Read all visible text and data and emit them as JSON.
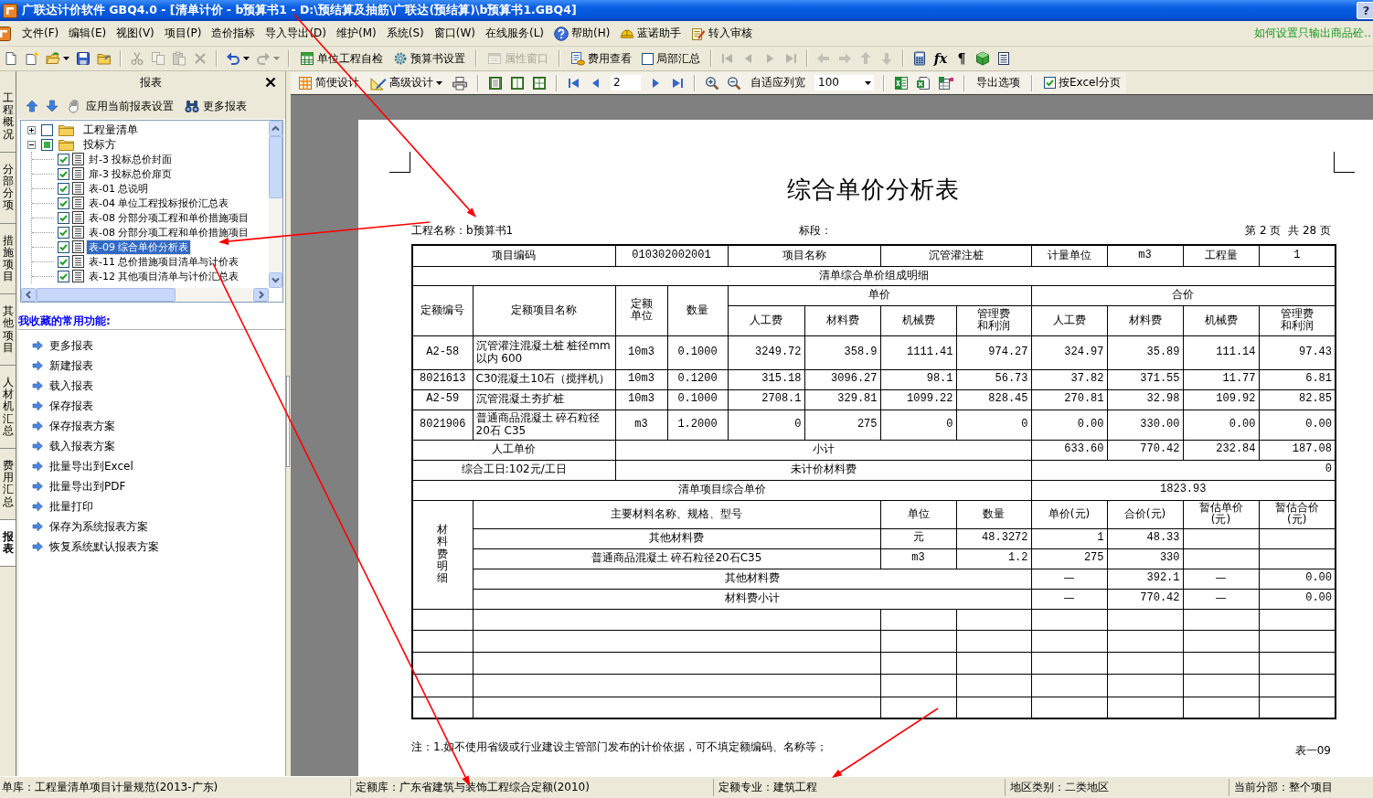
{
  "window": {
    "title": "广联达计价软件 GBQ4.0 - [清单计价 - b预算书1 - D:\\预结算及抽筋\\广联达(预结算)\\b预算书1.GBQ4]",
    "help_button": "?"
  },
  "menu": {
    "items": [
      {
        "label": "文件(F)",
        "kind": "text"
      },
      {
        "label": "编辑(E)",
        "kind": "text"
      },
      {
        "label": "视图(V)",
        "kind": "text"
      },
      {
        "label": "项目(P)",
        "kind": "text"
      },
      {
        "label": "造价指标",
        "kind": "text"
      },
      {
        "label": "导入导出(D)",
        "kind": "text"
      },
      {
        "label": "维护(M)",
        "kind": "text"
      },
      {
        "label": "系统(S)",
        "kind": "text"
      },
      {
        "label": "窗口(W)",
        "kind": "text"
      },
      {
        "label": "在线服务(L)",
        "kind": "text"
      },
      {
        "label": "帮助(H)",
        "kind": "help"
      },
      {
        "label": "蓝诺助手",
        "kind": "helper"
      },
      {
        "label": "转入审核",
        "kind": "review"
      }
    ],
    "tip_link": "如何设置只输出商品砼.."
  },
  "toolbar": [
    {
      "kind": "file",
      "disabled": false
    },
    {
      "kind": "edit",
      "disabled": true
    },
    {
      "kind": "undo",
      "disabled": false
    },
    {
      "kind": "redo",
      "disabled": true
    },
    {
      "kind": "button",
      "label": "单位工程自检",
      "disabled": false
    },
    {
      "kind": "button",
      "label": "预算书设置",
      "disabled": false
    },
    {
      "kind": "button",
      "label": "属性窗口",
      "disabled": true
    },
    {
      "kind": "button",
      "label": "费用查看",
      "disabled": false
    },
    {
      "kind": "checkbox",
      "label": "局部汇总",
      "checked": false
    },
    {
      "kind": "nav",
      "disabled": true
    },
    {
      "kind": "move",
      "disabled": true
    },
    {
      "kind": "tools",
      "disabled": false,
      "glyphs": [
        "fx",
        "¶"
      ]
    }
  ],
  "side_tabs": [
    {
      "label": "工程概况",
      "selected": false
    },
    {
      "label": "分部分项",
      "selected": false
    },
    {
      "label": "措施项目",
      "selected": false
    },
    {
      "label": "其他项目",
      "selected": false
    },
    {
      "label": "人材机汇总",
      "selected": false
    },
    {
      "label": "费用汇总",
      "selected": false
    },
    {
      "label": "报表",
      "selected": true
    }
  ],
  "report_panel": {
    "title": "报表",
    "apply_button": "应用当前报表设置",
    "more_button": "更多报表",
    "tree": [
      {
        "label": "工程量清单",
        "expanded": false,
        "checked": false,
        "partial": false,
        "selected": false
      },
      {
        "label": "投标方",
        "expanded": true,
        "checked": false,
        "partial": true,
        "selected": false,
        "children": [
          {
            "label": "封-3 投标总价封面",
            "checked": true,
            "selected": false
          },
          {
            "label": "扉-3 投标总价扉页",
            "checked": true,
            "selected": false
          },
          {
            "label": "表-01 总说明",
            "checked": true,
            "selected": false
          },
          {
            "label": "表-04 单位工程投标报价汇总表",
            "checked": true,
            "selected": false
          },
          {
            "label": "表-08 分部分项工程和单价措施项目",
            "checked": true,
            "selected": false
          },
          {
            "label": "表-08 分部分项工程和单价措施项目",
            "checked": true,
            "selected": false
          },
          {
            "label": "表-09 综合单价分析表",
            "checked": true,
            "selected": true
          },
          {
            "label": "表-11 总价措施项目清单与计价表",
            "checked": true,
            "selected": false
          },
          {
            "label": "表-12 其他项目清单与计价汇总表",
            "checked": true,
            "selected": false
          }
        ]
      }
    ],
    "favorites_title": "我收藏的常用功能:",
    "favorites": [
      "更多报表",
      "新建报表",
      "载入报表",
      "保存报表",
      "保存报表方案",
      "载入报表方案",
      "批量导出到Excel",
      "批量导出到PDF",
      "批量打印",
      "保存为系统报表方案",
      "恢复系统默认报表方案"
    ]
  },
  "report_toolbar": {
    "simple_design": "简便设计",
    "advanced_design": "高级设计",
    "page": "2",
    "fit_columns": "自适应列宽",
    "zoom": "100",
    "export_options": "导出选项",
    "excel_paging": {
      "label": "按Excel分页",
      "checked": true
    }
  },
  "report": {
    "title": "综合单价分析表",
    "project_name": "工程名称：b预算书1",
    "section": "标段：",
    "page_info": "第 2 页  共 28 页",
    "table": {
      "item_row": [
        "项目编码",
        "010302002001",
        "项目名称",
        "沉管灌注桩",
        "计量单位",
        "m3",
        "工程量",
        "1"
      ],
      "detail_title": "清单综合单价组成明细",
      "quota_columns": [
        "定额编号",
        "定额项目名称",
        "定额单位",
        "数量"
      ],
      "unit_price_group": "单价",
      "unit_price_columns": [
        "人工费",
        "材料费",
        "机械费",
        "管理费和利润"
      ],
      "total_price_group": "合价",
      "total_price_columns": [
        "人工费",
        "材料费",
        "机械费",
        "管理费和利润"
      ],
      "rows": [
        {
          "code": "A2-58",
          "name": "沉管灌注混凝土桩 桩径mm以内 600",
          "unit": "10m3",
          "quantity": "0.1000",
          "unit_prices": [
            "3249.72",
            "358.9",
            "1111.41",
            "974.27"
          ],
          "totals": [
            "324.97",
            "35.89",
            "111.14",
            "97.43"
          ]
        },
        {
          "code": "8021613",
          "name": "C30混凝土10石（搅拌机）",
          "unit": "10m3",
          "quantity": "0.1200",
          "unit_prices": [
            "315.18",
            "3096.27",
            "98.1",
            "56.73"
          ],
          "totals": [
            "37.82",
            "371.55",
            "11.77",
            "6.81"
          ]
        },
        {
          "code": "A2-59",
          "name": "沉管混凝土夯扩桩",
          "unit": "10m3",
          "quantity": "0.1000",
          "unit_prices": [
            "2708.1",
            "329.81",
            "1099.22",
            "828.45"
          ],
          "totals": [
            "270.81",
            "32.98",
            "109.92",
            "82.85"
          ]
        },
        {
          "code": "8021906",
          "name": "普通商品混凝土 碎石粒径20石 C35",
          "unit": "m3",
          "quantity": "1.2000",
          "unit_prices": [
            "0",
            "275",
            "0",
            "0"
          ],
          "totals": [
            "0.00",
            "330.00",
            "0.00",
            "0.00"
          ]
        }
      ],
      "labor_price_label": "人工单价",
      "subtotal_label": "小计",
      "subtotals": [
        "633.60",
        "770.42",
        "232.84",
        "187.08"
      ],
      "workday_label": "综合工日:102元/工日",
      "unpriced_label": "未计价材料费",
      "unpriced_value": "0",
      "composite_label": "清单项目综合单价",
      "composite_value": "1823.93",
      "materials": {
        "side_label": "材料费明细",
        "columns": [
          "主要材料名称、规格、型号",
          "单位",
          "数量",
          "单价(元)",
          "合价(元)",
          "暂估单价(元)",
          "暂估合价(元)"
        ],
        "rows": [
          {
            "kind": "item",
            "name": "其他材料费",
            "unit": "元",
            "quantity": "48.3272",
            "price": "1",
            "total": "48.33"
          },
          {
            "kind": "item",
            "name": "普通商品混凝土 碎石粒径20石C35",
            "unit": "m3",
            "quantity": "1.2",
            "price": "275",
            "total": "330"
          },
          {
            "kind": "summary",
            "name": "其他材料费",
            "price": "—",
            "total": "392.1",
            "estimated_price": "—",
            "estimated_total": "0.00"
          },
          {
            "kind": "summary",
            "name": "材料费小计",
            "price": "—",
            "total": "770.42",
            "estimated_price": "—",
            "estimated_total": "0.00"
          }
        ]
      }
    },
    "note": "注：1.如不使用省级或行业建设主管部门发布的计价依据，可不填定额编码、名称等；",
    "form_no": "表一09"
  },
  "status_bar": [
    "单库：工程量清单项目计量规范(2013-广东)",
    "定额库：广东省建筑与装饰工程综合定额(2010)",
    "定额专业：建筑工程",
    "地区类别：二类地区",
    "当前分部：整个项目"
  ]
}
